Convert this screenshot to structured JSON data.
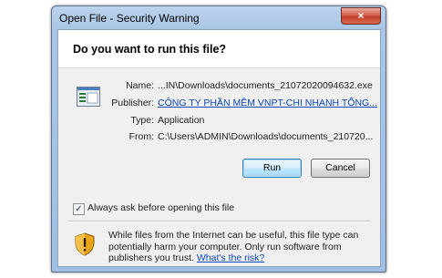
{
  "window": {
    "title": "Open File - Security Warning",
    "close_glyph": "×"
  },
  "dialog": {
    "question": "Do you want to run this file?",
    "file_icon": "executable-file-icon",
    "fields": {
      "name_label": "Name:",
      "name_value": "...IN\\Downloads\\documents_21072020094632.exe",
      "publisher_label": "Publisher:",
      "publisher_value": "CÔNG TY PHẦN MỀM VNPT-CHI NHANH TỔNG...",
      "type_label": "Type:",
      "type_value": "Application",
      "from_label": "From:",
      "from_value": "C:\\Users\\ADMIN\\Downloads\\documents_210720..."
    },
    "buttons": {
      "run": "Run",
      "cancel": "Cancel"
    },
    "checkbox": {
      "label": "Always ask before opening this file",
      "checked": true,
      "check_glyph": "✓"
    },
    "warning": {
      "icon": "security-shield-icon",
      "text": "While files from the Internet can be useful, this file type can potentially harm your computer. Only run software from publishers you trust.",
      "link": "What's the risk?"
    }
  },
  "colors": {
    "title_bar": "#aac6e6",
    "close_button": "#c94d38",
    "link": "#0b46b8",
    "dialog_body": "#f0f0f0"
  }
}
